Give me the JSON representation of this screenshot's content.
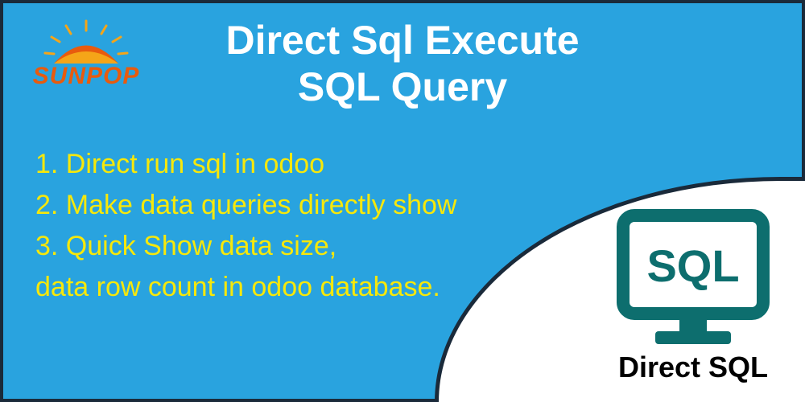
{
  "logo": {
    "text": "SUNPOP"
  },
  "title": {
    "line1": "Direct Sql Execute",
    "line2": "SQL Query"
  },
  "features": {
    "line1": "1.  Direct run sql in odoo",
    "line2": "2.  Make data queries directly show",
    "line3": "3.  Quick Show data size,",
    "line4": "data row count in odoo database."
  },
  "sql": {
    "badge": "SQL",
    "caption": "Direct SQL"
  },
  "colors": {
    "background": "#29a3df",
    "accent_yellow": "#f7e80a",
    "logo_orange": "#e85b0e",
    "icon_teal": "#0d6e6e"
  }
}
